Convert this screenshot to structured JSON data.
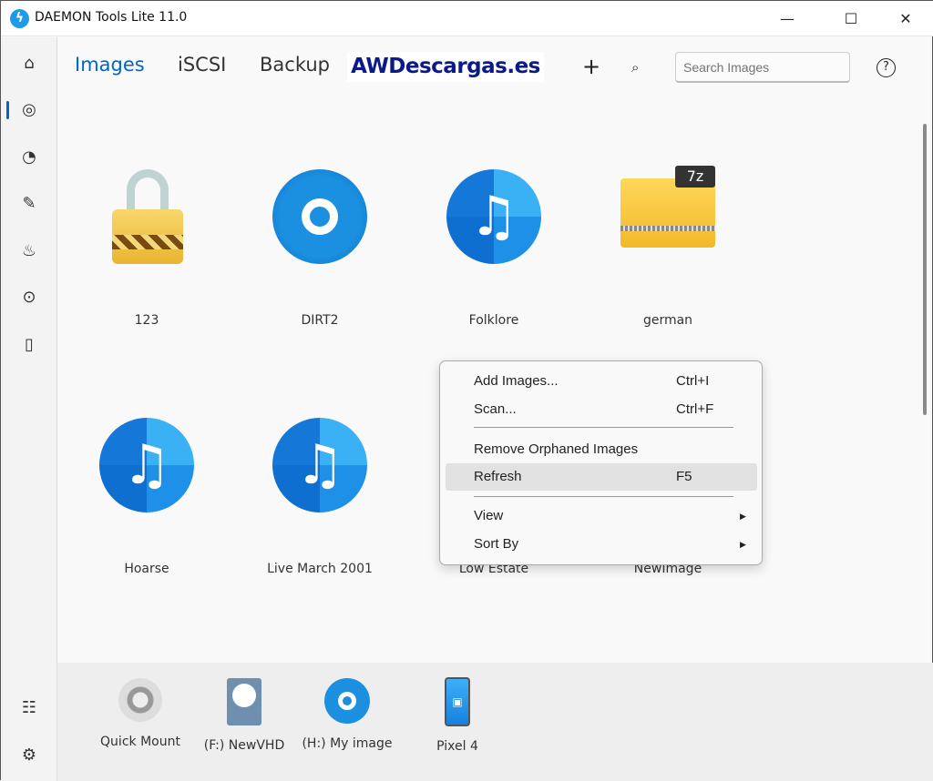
{
  "window": {
    "title": "DAEMON Tools Lite 11.0",
    "minimize": "—",
    "maximize": "☐",
    "close": "✕"
  },
  "sidebar": {
    "items": [
      {
        "icon": "home-icon",
        "g": "⌂"
      },
      {
        "icon": "disc-icon",
        "g": "◎"
      },
      {
        "icon": "virtual-drive-icon",
        "g": "◔"
      },
      {
        "icon": "pencil-icon",
        "g": "✎"
      },
      {
        "icon": "flame-icon",
        "g": "♨"
      },
      {
        "icon": "disc-search-icon",
        "g": "⊙"
      },
      {
        "icon": "usb-icon",
        "g": "▯"
      }
    ],
    "bottom": [
      {
        "icon": "license-icon",
        "g": "☷"
      },
      {
        "icon": "settings-icon",
        "g": "⚙"
      }
    ]
  },
  "tabs": [
    {
      "label": "Images",
      "active": true
    },
    {
      "label": "iSCSI"
    },
    {
      "label": "Backup"
    }
  ],
  "watermark": "AWDescargas.es",
  "toolbar": {
    "add": "+",
    "search_icon": "⌕",
    "search_placeholder": "Search Images",
    "help": "?"
  },
  "images": [
    {
      "name": "123",
      "icon": "lock"
    },
    {
      "name": "DIRT2",
      "icon": "disc"
    },
    {
      "name": "Folklore",
      "icon": "music"
    },
    {
      "name": "german",
      "icon": "7z",
      "tag": "7z"
    },
    {
      "name": "Hoarse",
      "icon": "music"
    },
    {
      "name": "Live March 2001",
      "icon": "music"
    },
    {
      "name": "Low Estate",
      "icon": "music"
    },
    {
      "name": "NewImage",
      "icon": "disc"
    }
  ],
  "context_menu": {
    "items": [
      {
        "label": "Add Images...",
        "shortcut": "Ctrl+I"
      },
      {
        "label": "Scan...",
        "shortcut": "Ctrl+F"
      },
      {
        "label": "Remove Orphaned Images",
        "shortcut": ""
      },
      {
        "label": "Refresh",
        "shortcut": "F5",
        "highlighted": true
      },
      {
        "label": "View",
        "shortcut": "",
        "arrow": "▶"
      },
      {
        "label": "Sort By",
        "shortcut": "",
        "arrow": "▶"
      }
    ]
  },
  "devices": [
    {
      "label": "Quick Mount"
    },
    {
      "label": "(F:) NewVHD"
    },
    {
      "label": "(H:) My image"
    },
    {
      "label": "Pixel 4"
    }
  ],
  "colors": {
    "accent": "#0067c0",
    "disc": "#1b8fe0"
  }
}
